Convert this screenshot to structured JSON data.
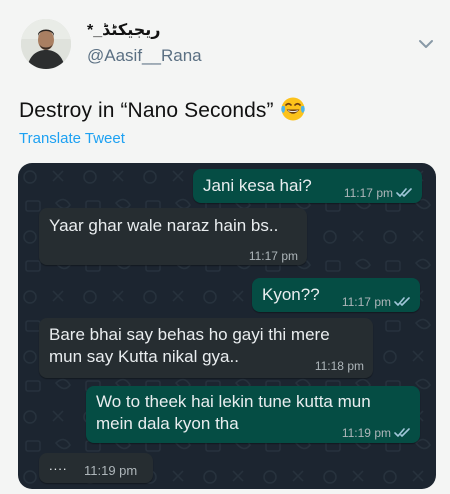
{
  "tweet": {
    "display_name": "ریجیکٹڈ_*",
    "handle": "@Aasif__Rana",
    "text": "Destroy in “Nano Seconds”",
    "emoji": "tears-of-joy-emoji",
    "translate_label": "Translate Tweet"
  },
  "chat": {
    "messages": [
      {
        "direction": "outgoing",
        "lines": [
          "Jani kesa hai?"
        ],
        "time": "11:17 pm",
        "status": "read"
      },
      {
        "direction": "incoming",
        "lines": [
          "Yaar ghar wale naraz hain bs.."
        ],
        "time": "11:17 pm"
      },
      {
        "direction": "outgoing",
        "lines": [
          "Kyon??"
        ],
        "time": "11:17 pm",
        "status": "read"
      },
      {
        "direction": "incoming",
        "lines": [
          "Bare bhai say behas ho gayi thi mere",
          "mun say Kutta nikal gya.."
        ],
        "time": "11:18 pm"
      },
      {
        "direction": "outgoing",
        "lines": [
          "Wo to theek hai lekin tune kutta mun",
          "mein dala kyon tha"
        ],
        "time": "11:19 pm",
        "status": "read"
      },
      {
        "direction": "incoming",
        "lines": [
          "...."
        ],
        "time": "11:19 pm"
      }
    ]
  },
  "colors": {
    "chat_background": "#1c2530",
    "outgoing_bubble": "#054d44",
    "incoming_bubble": "#262d31",
    "link_blue": "#1da1f2",
    "read_ticks": "#9fc6d8"
  }
}
